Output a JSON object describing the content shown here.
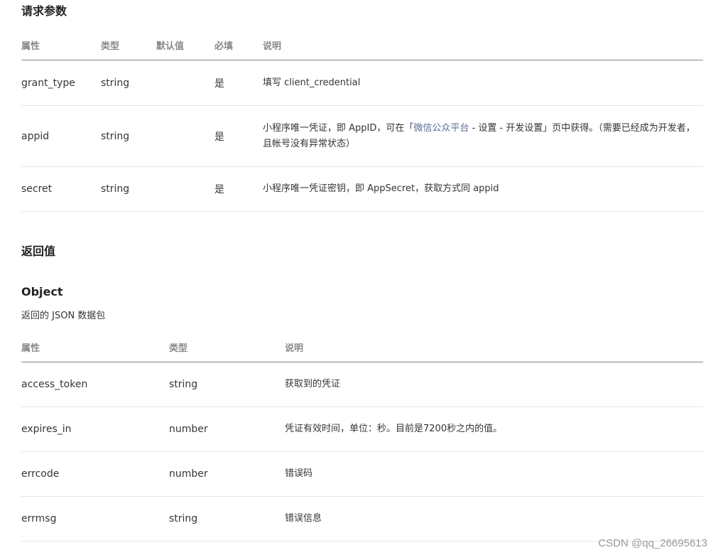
{
  "request": {
    "title": "请求参数",
    "headers": [
      "属性",
      "类型",
      "默认值",
      "必填",
      "说明"
    ],
    "rows": [
      {
        "name": "grant_type",
        "type": "string",
        "default": "",
        "required": "是",
        "desc_pre": "填写 client_credential",
        "desc_link": "",
        "desc_post": ""
      },
      {
        "name": "appid",
        "type": "string",
        "default": "",
        "required": "是",
        "desc_pre": "小程序唯一凭证，即 AppID，可在「",
        "desc_link": "微信公众平台",
        "desc_post": " - 设置 - 开发设置」页中获得。（需要已经成为开发者，且帐号没有异常状态）"
      },
      {
        "name": "secret",
        "type": "string",
        "default": "",
        "required": "是",
        "desc_pre": "小程序唯一凭证密钥，即 AppSecret，获取方式同 appid",
        "desc_link": "",
        "desc_post": ""
      }
    ]
  },
  "response": {
    "title": "返回值",
    "object_title": "Object",
    "object_desc": "返回的 JSON 数据包",
    "headers": [
      "属性",
      "类型",
      "说明"
    ],
    "rows": [
      {
        "name": "access_token",
        "type": "string",
        "desc": "获取到的凭证"
      },
      {
        "name": "expires_in",
        "type": "number",
        "desc": "凭证有效时间，单位：秒。目前是7200秒之内的值。"
      },
      {
        "name": "errcode",
        "type": "number",
        "desc": "错误码"
      },
      {
        "name": "errmsg",
        "type": "string",
        "desc": "错误信息"
      }
    ]
  },
  "watermark": "CSDN @qq_26695613"
}
